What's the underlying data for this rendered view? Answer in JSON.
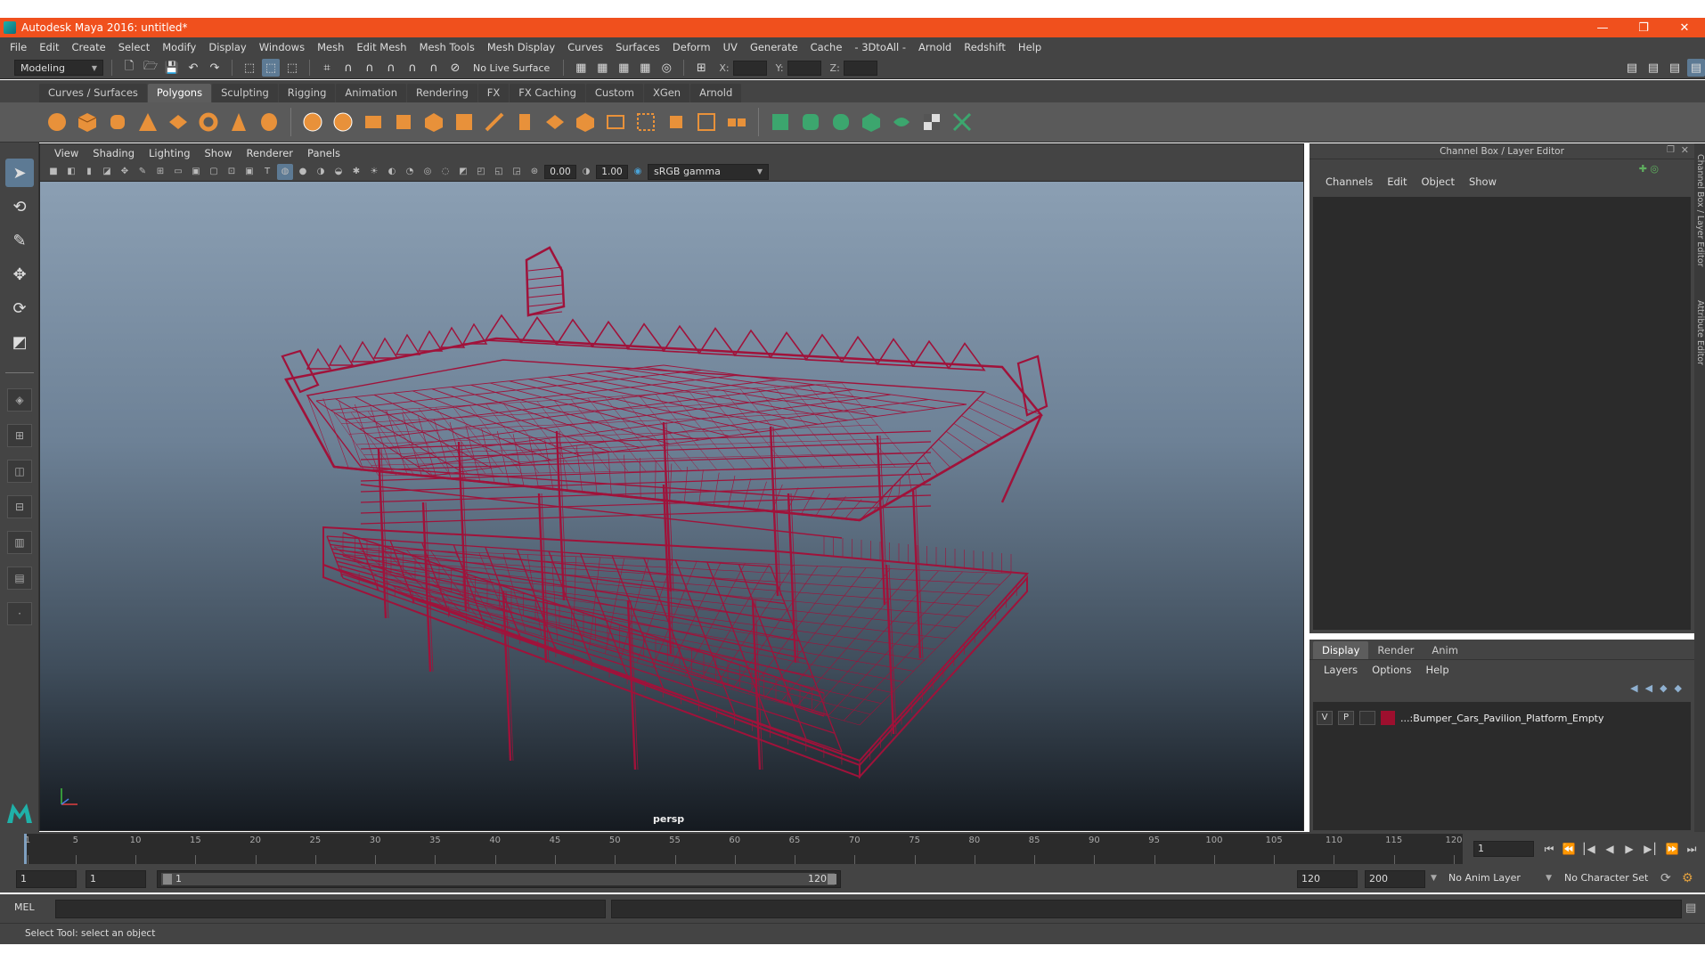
{
  "window": {
    "title": "Autodesk Maya 2016: untitled*",
    "minimize": "—",
    "restore": "❐",
    "close": "✕"
  },
  "menubar": [
    "File",
    "Edit",
    "Create",
    "Select",
    "Modify",
    "Display",
    "Windows",
    "Mesh",
    "Edit Mesh",
    "Mesh Tools",
    "Mesh Display",
    "Curves",
    "Surfaces",
    "Deform",
    "UV",
    "Generate",
    "Cache",
    "- 3DtoAll -",
    "Arnold",
    "Redshift",
    "Help"
  ],
  "statusline": {
    "mode": "Modeling",
    "live_surface": "No Live Surface",
    "x_label": "X:",
    "y_label": "Y:",
    "z_label": "Z:"
  },
  "shelf_tabs": [
    "Curves / Surfaces",
    "Polygons",
    "Sculpting",
    "Rigging",
    "Animation",
    "Rendering",
    "FX",
    "FX Caching",
    "Custom",
    "XGen",
    "Arnold"
  ],
  "shelf_active": "Polygons",
  "panel": {
    "menu": [
      "View",
      "Shading",
      "Lighting",
      "Show",
      "Renderer",
      "Panels"
    ],
    "exposure": "0.00",
    "gamma": "1.00",
    "color_space": "sRGB gamma",
    "camera": "persp"
  },
  "model": {
    "wire_color": "#a0123a"
  },
  "channelbox": {
    "title": "Channel Box / Layer Editor",
    "menu": [
      "Channels",
      "Edit",
      "Object",
      "Show"
    ]
  },
  "layereditor": {
    "tabs": [
      "Display",
      "Render",
      "Anim"
    ],
    "menu": [
      "Layers",
      "Options",
      "Help"
    ],
    "layer": {
      "v": "V",
      "p": "P",
      "name": "...:Bumper_Cars_Pavilion_Platform_Empty",
      "color": "#9d0f2e"
    }
  },
  "sidetabs": [
    "Channel Box / Layer Editor",
    "Attribute Editor"
  ],
  "timeline": {
    "ticks": [
      1,
      5,
      10,
      15,
      20,
      25,
      30,
      35,
      40,
      45,
      50,
      55,
      60,
      65,
      70,
      75,
      80,
      85,
      90,
      95,
      100,
      105,
      110,
      115,
      120
    ],
    "current_frame": "1",
    "range_start": "1",
    "playback_start": "1",
    "range_bar_start": "1",
    "range_bar_end": "120",
    "playback_end": "120",
    "range_end": "200",
    "anim_layer": "No Anim Layer",
    "character_set": "No Character Set"
  },
  "cmdline": {
    "label": "MEL"
  },
  "helpline": {
    "text": "Select Tool: select an object"
  }
}
